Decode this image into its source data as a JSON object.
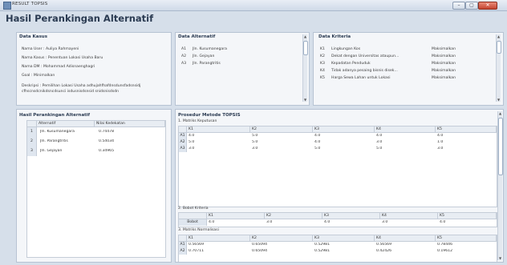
{
  "window": {
    "title": "RESULT TOPSIS",
    "min": "–",
    "max": "▢",
    "close": "✕"
  },
  "heading": "Hasil Perankingan Alternatif",
  "data_kasus": {
    "title": "Data Kasus",
    "nama_user": "Nama User : Auliya Rahmayeni",
    "nama_kasus": "Nama Kasus : Penentuan Lokasi Usaha Baru",
    "nama_dm": "Nama DM : Mohammad Adisnaenghagri",
    "goal": "Goal : Minimalkan",
    "deskripsi1": "Deskripsi : Pemilihan Lokasi Usaha adhujahfhafdnsdunsfadsnsidj",
    "deskripsi2": "cfhscnsdcnikdsncdsunci isdusnisdsnsid snidsnisdsdn"
  },
  "data_alternatif": {
    "title": "Data Alternatif",
    "items": [
      {
        "code": "A1",
        "name": "Jln. Kusumanegara"
      },
      {
        "code": "A2",
        "name": "Jln. Gejayan"
      },
      {
        "code": "A3",
        "name": "Jln. Parangtritis"
      }
    ]
  },
  "data_kriteria": {
    "title": "Data Kriteria",
    "items": [
      {
        "code": "K1",
        "name": "Lingkungan Kos",
        "type": "Maksimalkan"
      },
      {
        "code": "K2",
        "name": "Dekat dengan Universitas ataupun...",
        "type": "Maksimalkan"
      },
      {
        "code": "K3",
        "name": "Kepadatan Penduduk",
        "type": "Maksimalkan"
      },
      {
        "code": "K4",
        "name": "Tidak adanya pesaing bisnis disek...",
        "type": "Maksimalkan"
      },
      {
        "code": "K5",
        "name": "Harga Sewa Lahan untuk Lokasi",
        "type": "Maksimalkan"
      }
    ]
  },
  "ranking": {
    "title": "Hasil Perankingan Alternatif",
    "headers": [
      "Alternatif",
      "Nilai Kedekatan"
    ],
    "rows": [
      {
        "rank": "1",
        "alt": "Jln. Kusumanegara",
        "value": "0.74478"
      },
      {
        "rank": "2",
        "alt": "Jln. Parangtritis",
        "value": "0.54034"
      },
      {
        "rank": "3",
        "alt": "Jln. Gejayan",
        "value": "0.34965"
      }
    ]
  },
  "prosedur": {
    "title": "Prosedur Metode TOPSIS",
    "m1_title": "1. Matriks Keputusan",
    "m1_headers": [
      "K1",
      "K2",
      "K3",
      "K4",
      "K5"
    ],
    "m1_rows": [
      {
        "label": "A1",
        "values": [
          "4.0",
          "5.0",
          "4.0",
          "4.0",
          "4.0"
        ]
      },
      {
        "label": "A2",
        "values": [
          "5.0",
          "5.0",
          "4.0",
          "3.0",
          "1.0"
        ]
      },
      {
        "label": "A3",
        "values": [
          "3.0",
          "3.0",
          "5.0",
          "5.0",
          "3.0"
        ]
      }
    ],
    "m2_title": "2. Bobot Kriteria",
    "m2_headers": [
      "K1",
      "K2",
      "K3",
      "K4",
      "K5"
    ],
    "m2_row": {
      "label": "Bobot",
      "values": [
        "4.0",
        "3.0",
        "4.0",
        "3.0",
        "4.0"
      ]
    },
    "m3_title": "3. Matriks Normalisasi",
    "m3_headers": [
      "K1",
      "K2",
      "K3",
      "K4",
      "K5"
    ],
    "m3_rows": [
      {
        "label": "A1",
        "values": [
          "0.56569",
          "0.65094",
          "0.52981",
          "0.56569",
          "0.78446"
        ]
      },
      {
        "label": "A2",
        "values": [
          "0.70711",
          "0.65094",
          "0.52981",
          "0.42426",
          "0.19612"
        ]
      }
    ]
  }
}
